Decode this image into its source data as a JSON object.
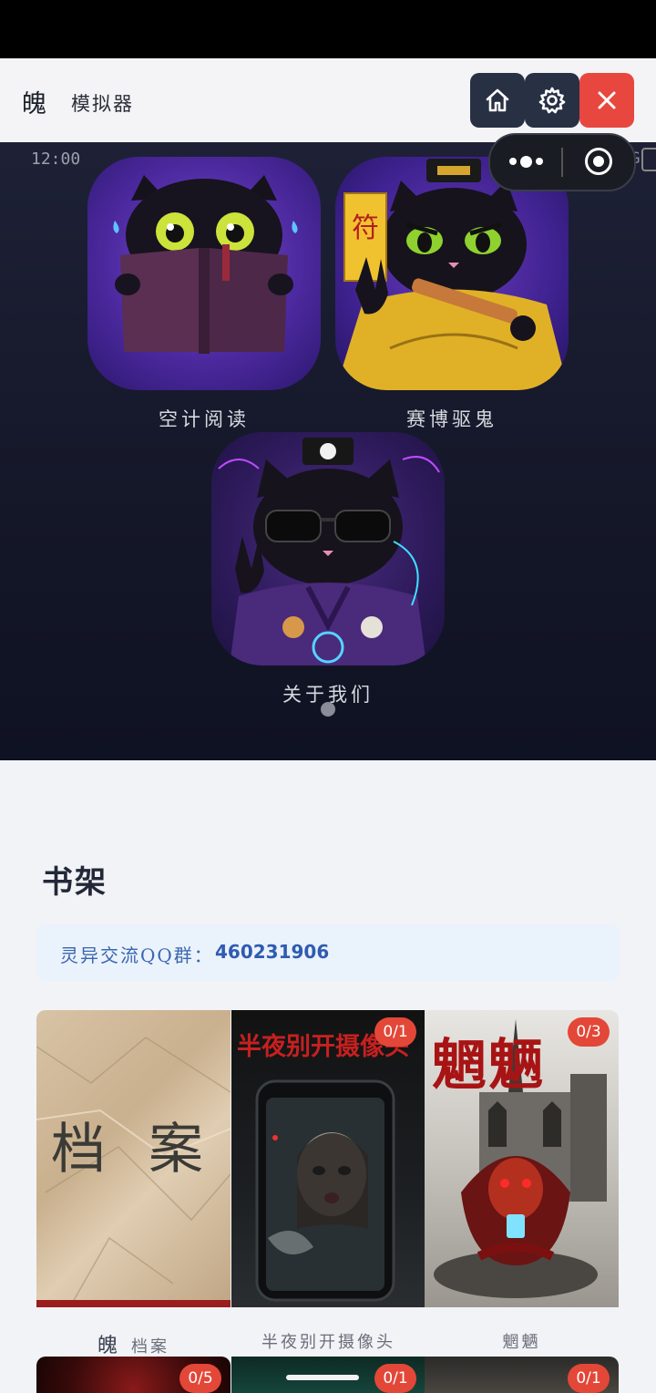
{
  "header": {
    "title": "魄",
    "subtitle": "模拟器",
    "home_icon": "home-icon",
    "settings_icon": "gear-icon",
    "close_icon": "close-icon",
    "close_color": "#e8473f"
  },
  "emulator": {
    "time": "12:00",
    "signal": "5G",
    "capsule_more_icon": "more-dots-icon",
    "capsule_target_icon": "target-icon",
    "apps": [
      {
        "label": "空计阅读",
        "icon": "crying-cat-book-icon"
      },
      {
        "label": "赛博驱鬼",
        "icon": "taoist-cat-sword-icon"
      },
      {
        "label": "关于我们",
        "icon": "cool-cat-sunglasses-icon"
      }
    ]
  },
  "bookshelf": {
    "title": "书架",
    "qq_label": "灵异交流QQ群：",
    "qq_number": "460231906",
    "books": [
      {
        "cover_text": "档 案",
        "title_main": "魄",
        "title_rest": "档案",
        "badge": ""
      },
      {
        "cover_text": "半夜别开摄像头",
        "title": "半夜别开摄像头",
        "badge": "0/1"
      },
      {
        "cover_text": "魍魉",
        "title": "魍魉",
        "badge": "0/3"
      }
    ],
    "more_books": [
      {
        "badge": "0/5"
      },
      {
        "badge": "0/1"
      },
      {
        "badge": "0/1"
      }
    ]
  }
}
